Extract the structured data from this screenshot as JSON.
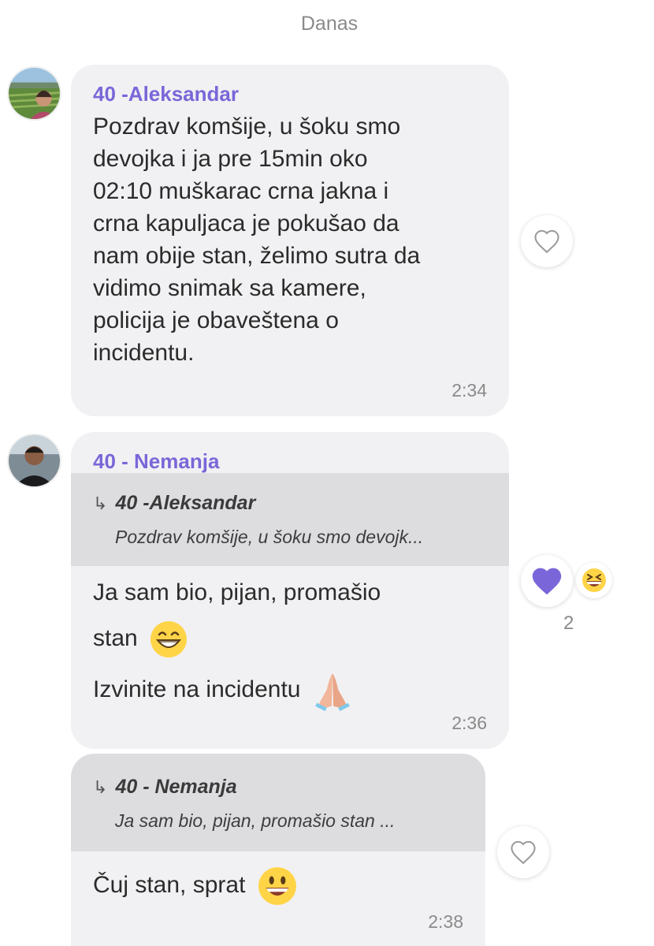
{
  "date_separator": "Danas",
  "messages": [
    {
      "sender": "40 -Aleksandar",
      "lines": [
        "Pozdrav komšije, u šoku smo",
        "devojka i ja pre 15min oko",
        "02:10 muškarac crna jakna i",
        "crna kapuljaca je pokušao da",
        "nam obije stan, želimo sutra da",
        "vidimo snimak sa kamere,",
        "policija je obaveštena o",
        "incidentu."
      ],
      "time": "2:34",
      "reaction": "heart-outline"
    },
    {
      "sender": "40 - Nemanja",
      "quote": {
        "author": "40 -Aleksandar",
        "text": "Pozdrav komšije, u šoku smo devojk..."
      },
      "line1": "Ja sam bio, pijan, promašio",
      "line2": "stan",
      "line2_emoji": "grinning-face-with-smiling-eyes",
      "line3": "Izvinite na incidentu",
      "line3_emoji": "folded-hands",
      "time": "2:36",
      "reaction": "heart-filled",
      "reaction_emoji": "grinning-squinting-face",
      "reaction_count": "2",
      "reaction_color": "#7b66d9"
    },
    {
      "quote": {
        "author": "40 - Nemanja",
        "text": "Ja sam bio, pijan, promašio stan ..."
      },
      "text": "Čuj stan, sprat",
      "emoji": "grinning-face",
      "time": "2:38",
      "reaction": "heart-outline"
    }
  ]
}
